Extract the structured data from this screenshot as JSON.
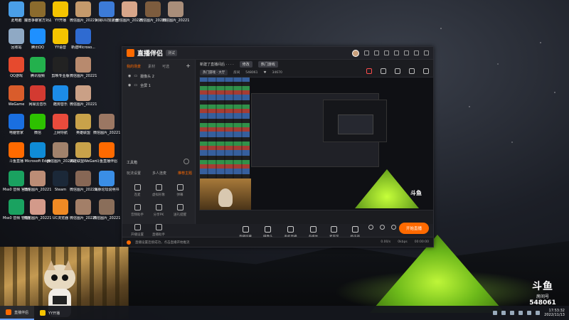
{
  "desktop": {
    "icons": [
      {
        "label": "此电脑",
        "color": "#4a9fe8"
      },
      {
        "label": "魔兽争霸官方对战平台",
        "color": "#8b6b2d"
      },
      {
        "label": "YY开播",
        "color": "#f5c400"
      },
      {
        "label": "微信图片_2022101...",
        "color": "#c49a6c"
      },
      {
        "label": "网易UU加速器",
        "color": "#3c7bd8"
      },
      {
        "label": "微信图片_2022110...",
        "color": "#d8a68a"
      },
      {
        "label": "微信图片_2022111...",
        "color": "#7d5c3e"
      },
      {
        "label": "微信图片_2022111...",
        "color": "#a98e7a"
      },
      {
        "label": "回收站",
        "color": "#8fa9c4"
      },
      {
        "label": "腾讯QQ",
        "color": "#1e90ff"
      },
      {
        "label": "YY语音",
        "color": "#f5c400"
      },
      {
        "label": "新建Microso...",
        "color": "#2f6bd1"
      },
      {
        "label": "QQ游戏",
        "color": "#e64a2e"
      },
      {
        "label": "腾讯视频",
        "color": "#23b14d"
      },
      {
        "label": "剪映专业版",
        "color": "#222"
      },
      {
        "label": "微信图片_2022101...",
        "color": "#b88a6e"
      },
      {
        "label": "WeGame",
        "color": "#d95c2b"
      },
      {
        "label": "网易云音乐",
        "color": "#d33a31"
      },
      {
        "label": "酷狗音乐",
        "color": "#1c8ce8"
      },
      {
        "label": "微信图片_2022101...",
        "color": "#caa086"
      },
      {
        "label": "电脑管家",
        "color": "#1a6fe0"
      },
      {
        "label": "微信",
        "color": "#2dc100"
      },
      {
        "label": "上网导航",
        "color": "#e84b3c"
      },
      {
        "label": "英雄联盟",
        "color": "#c8a24a"
      },
      {
        "label": "微信图片_2022101...",
        "color": "#9b7763"
      },
      {
        "label": "斗鱼直播",
        "color": "#ff6a00"
      },
      {
        "label": "Microsoft Edge",
        "color": "#0f8bd6"
      },
      {
        "label": "微信图片_2022101...",
        "color": "#a1826c"
      },
      {
        "label": "英雄联盟WeGame版",
        "color": "#c8a24a"
      },
      {
        "label": "斗鱼直播伴侣",
        "color": "#ff6a00"
      },
      {
        "label": "Mss0 音频 官方版 1.43",
        "color": "#1aa260"
      },
      {
        "label": "微信图片_2022111...",
        "color": "#bc8d76"
      },
      {
        "label": "Steam",
        "color": "#1b2838"
      },
      {
        "label": "微信图片_2022111...",
        "color": "#876755"
      },
      {
        "label": "海豚论坛说明书",
        "color": "#3a8ee6"
      },
      {
        "label": "Mss0 音频 管理器 1.17",
        "color": "#1aa260"
      },
      {
        "label": "微信图片_2022111...",
        "color": "#d39a8a"
      },
      {
        "label": "UC浏览器",
        "color": "#f08a24"
      },
      {
        "label": "微信图片_2022111...",
        "color": "#a37f68"
      },
      {
        "label": "微信图片_2022111...",
        "color": "#8a6e5a"
      }
    ]
  },
  "app": {
    "name": "直播伴侣",
    "badge": "测试",
    "left_tabs": [
      "我的场景",
      "素材",
      "可选"
    ],
    "plus": "+",
    "scenes": [
      "摄像头 2",
      "全屏 1"
    ],
    "tools_title": "工具箱",
    "tools_tabs": [
      "玩法设置",
      "多人连麦",
      "推荐主题"
    ],
    "tools": [
      "连麦",
      "虚拟形象",
      "弹幕",
      "音频助手",
      "分享PK",
      "送礼提醒",
      "开播设置",
      "直播助手"
    ],
    "info": {
      "title": "新建了直播间后 · · · ·",
      "edit_chip": "修改",
      "category_chip": "热门游戏",
      "sub_chip": "热门游戏 · 大厅",
      "room_label": "房间",
      "room_no": "548061",
      "fans_no": "34670"
    },
    "controls": [
      "直播屏幕",
      "摄像头",
      "手机直播",
      "多媒体",
      "麦克风",
      "扬声器"
    ],
    "start_button": "开始直播",
    "status_msg": "直播设置连接成功，点击直播开始推流",
    "status_right": [
      "0.00/s",
      "0kbps",
      "00:00:00"
    ]
  },
  "douyu_badge": {
    "big": "斗鱼",
    "label": "房间号",
    "room": "548061"
  },
  "taskbar": {
    "items": [
      {
        "label": "直播伴侣",
        "color": "#ff6a00"
      },
      {
        "label": "YY开播",
        "color": "#f5c400"
      }
    ],
    "time": "17:53:32",
    "date": "2022/11/13"
  }
}
